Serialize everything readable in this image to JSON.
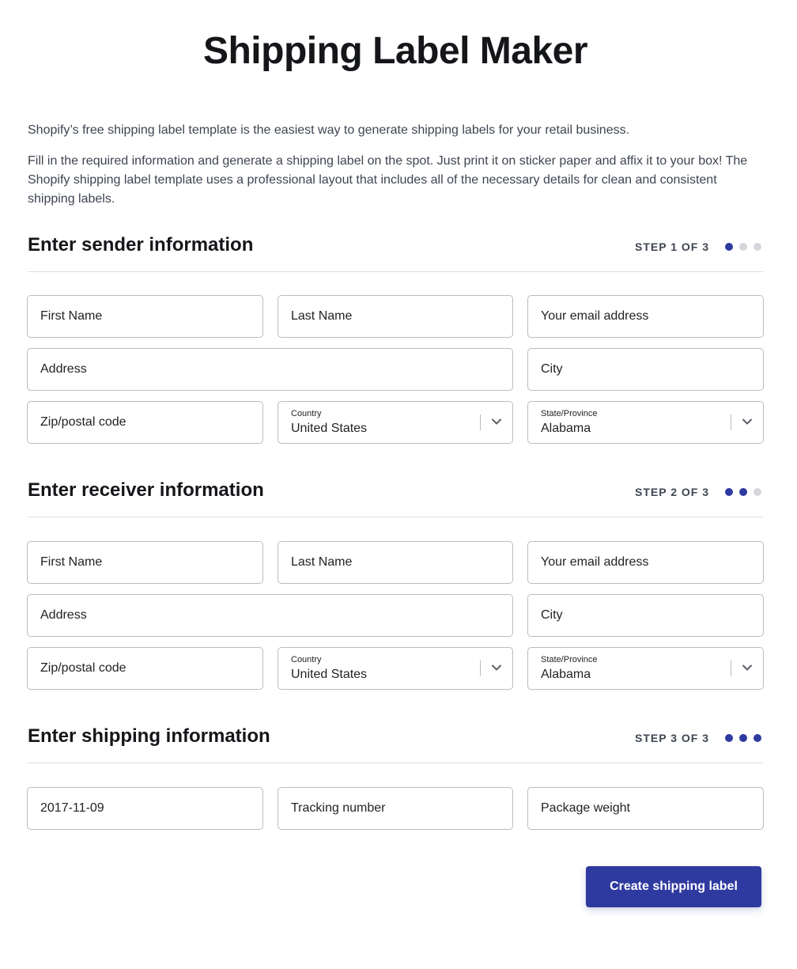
{
  "header": {
    "title": "Shipping Label Maker"
  },
  "intro": {
    "paragraph_1": "Shopify’s free shipping label template is the easiest way to generate shipping labels for your retail business.",
    "paragraph_2": "Fill in the required information and generate a shipping label on the spot. Just print it on sticker paper and affix it to your box! The Shopify shipping label template uses a professional layout that includes all of the necessary details for clean and consistent shipping labels."
  },
  "colors": {
    "accent": "#2f3aa0",
    "dot_inactive": "#d6d7dc",
    "border": "#b9bcc2"
  },
  "sender": {
    "title": "Enter sender information",
    "step": "STEP 1 OF 3",
    "steps_done": 1,
    "steps_total": 3,
    "first_name_placeholder": "First Name",
    "last_name_placeholder": "Last Name",
    "email_placeholder": "Your email address",
    "address_placeholder": "Address",
    "city_placeholder": "City",
    "zip_placeholder": "Zip/postal code",
    "country_label": "Country",
    "country_value": "United States",
    "state_label": "State/Province",
    "state_value": "Alabama"
  },
  "receiver": {
    "title": "Enter receiver information",
    "step": "STEP 2 OF 3",
    "steps_done": 2,
    "steps_total": 3,
    "first_name_placeholder": "First Name",
    "last_name_placeholder": "Last Name",
    "email_placeholder": "Your email address",
    "address_placeholder": "Address",
    "city_placeholder": "City",
    "zip_placeholder": "Zip/postal code",
    "country_label": "Country",
    "country_value": "United States",
    "state_label": "State/Province",
    "state_value": "Alabama"
  },
  "shipping": {
    "title": "Enter shipping information",
    "step": "STEP 3 OF 3",
    "steps_done": 3,
    "steps_total": 3,
    "date_value": "2017-11-09",
    "tracking_placeholder": "Tracking number",
    "weight_placeholder": "Package weight"
  },
  "actions": {
    "create_label": "Create shipping label"
  }
}
